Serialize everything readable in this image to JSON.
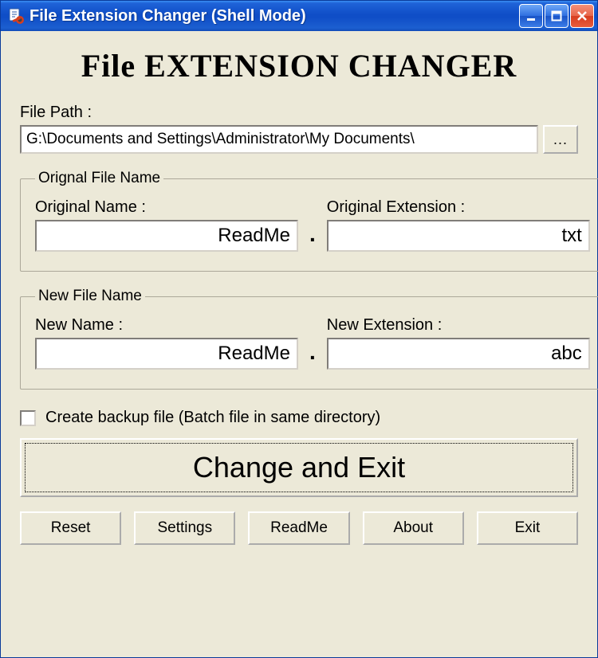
{
  "titlebar": {
    "title": "File Extension Changer (Shell Mode)"
  },
  "app_title": "File EXTENSION CHANGER",
  "file_path": {
    "label": "File Path :",
    "value": "G:\\Documents and Settings\\Administrator\\My Documents\\",
    "browse": "..."
  },
  "original_group": {
    "legend": "Orignal File Name",
    "name_label": "Original Name :",
    "name_value": "ReadMe",
    "ext_label": "Original Extension :",
    "ext_value": "txt"
  },
  "new_group": {
    "legend": "New File Name",
    "name_label": "New Name :",
    "name_value": "ReadMe",
    "ext_label": "New Extension :",
    "ext_value": "abc"
  },
  "dot": ".",
  "backup": {
    "label": "Create backup file (Batch file in same directory)",
    "checked": false
  },
  "main_button": "Change and Exit",
  "buttons": {
    "reset": "Reset",
    "settings": "Settings",
    "readme": "ReadMe",
    "about": "About",
    "exit": "Exit"
  }
}
